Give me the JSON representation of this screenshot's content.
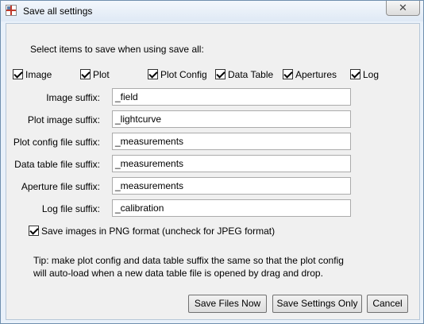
{
  "window": {
    "title": "Save all settings",
    "close_glyph": "✕"
  },
  "intro": "Select items to save when using save all:",
  "items": [
    {
      "label": "Image",
      "checked": true
    },
    {
      "label": "Plot",
      "checked": true
    },
    {
      "label": "Plot Config",
      "checked": true
    },
    {
      "label": "Data Table",
      "checked": true
    },
    {
      "label": "Apertures",
      "checked": true
    },
    {
      "label": "Log",
      "checked": true
    }
  ],
  "suffixes": [
    {
      "label": "Image suffix:",
      "value": "_field"
    },
    {
      "label": "Plot image suffix:",
      "value": "_lightcurve"
    },
    {
      "label": "Plot config file suffix:",
      "value": "_measurements"
    },
    {
      "label": "Data table file suffix:",
      "value": "_measurements"
    },
    {
      "label": "Aperture file suffix:",
      "value": "_measurements"
    },
    {
      "label": "Log file suffix:",
      "value": "_calibration"
    }
  ],
  "png_option": {
    "label": "Save images in PNG format (uncheck for JPEG format)",
    "checked": true
  },
  "tip": {
    "line1": "Tip: make plot config and data table suffix the same so that the plot config",
    "line2": "will auto-load when a new data table file is opened by drag and drop."
  },
  "buttons": {
    "save_files": "Save Files Now",
    "save_settings": "Save Settings Only",
    "cancel": "Cancel"
  }
}
